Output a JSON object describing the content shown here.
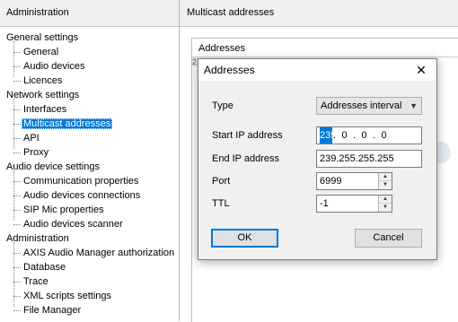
{
  "left_panel": {
    "header": "Administration",
    "groups": [
      {
        "label": "General settings",
        "children": [
          "General",
          "Audio devices",
          "Licences"
        ]
      },
      {
        "label": "Network settings",
        "children": [
          "Interfaces",
          "Multicast addresses",
          "API",
          "Proxy"
        ]
      },
      {
        "label": "Audio device settings",
        "children": [
          "Communication properties",
          "Audio devices connections",
          "SIP Mic properties",
          "Audio devices scanner"
        ]
      },
      {
        "label": "Administration",
        "children": [
          "AXIS Audio Manager authorization",
          "Database",
          "Trace",
          "XML scripts settings",
          "File Manager"
        ]
      }
    ],
    "selected": "Multicast addresses"
  },
  "right_panel": {
    "header": "Multicast addresses",
    "table_header": "Addresses",
    "row_marker": "2"
  },
  "dialog": {
    "title": "Addresses",
    "close": "✕",
    "type_label": "Type",
    "type_value": "Addresses interval",
    "start_ip_label": "Start IP address",
    "start_ip": [
      "239",
      "0",
      "0",
      "0"
    ],
    "ip_separator": ".",
    "end_ip_label": "End IP address",
    "end_ip": "239.255.255.255",
    "port_label": "Port",
    "port_value": "6999",
    "ttl_label": "TTL",
    "ttl_value": "-1",
    "ok_label": "OK",
    "cancel_label": "Cancel"
  },
  "colors": {
    "selection": "#0078d7",
    "dialog_body": "#f0f0f0"
  }
}
